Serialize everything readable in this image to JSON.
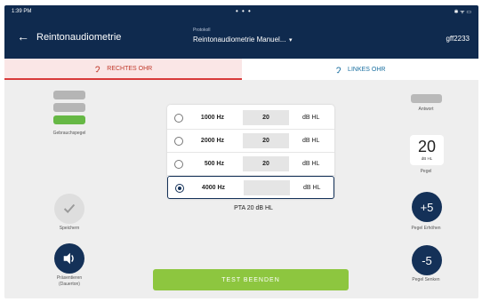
{
  "status_bar": {
    "time": "1:39 PM",
    "dots": "• • •",
    "icons": "✱ ᯤ ▭"
  },
  "app_bar": {
    "back_icon": "←",
    "title": "Reintonaudiometrie",
    "protocol_label": "Protokoll",
    "protocol_value": "Reintonaudiometrie Manuel...",
    "dropdown_icon": "▾",
    "user": "gff2233"
  },
  "tabs": {
    "right": {
      "label": "RECHTES OHR",
      "color": "#c0392b"
    },
    "left": {
      "label": "LINKES OHR",
      "color": "#1a6fa0"
    }
  },
  "left_panel": {
    "comfort_level_label": "Gebrauchspegel",
    "level_bar_colors": [
      "#b5b5b5",
      "#b5b5b5",
      "#66b845"
    ],
    "save_label": "Speichern",
    "present_label_1": "Präsentieren",
    "present_label_2": "(Dauerton)"
  },
  "right_panel": {
    "answer_label": "Antwort",
    "level_value": "20",
    "level_unit": "dB HL",
    "level_label": "Pegel",
    "increase_symbol": "+5",
    "increase_label": "Pegel Erhöhen",
    "decrease_symbol": "-5",
    "decrease_label": "Pegel Senken"
  },
  "frequencies": [
    {
      "freq": "1000 Hz",
      "value": "20",
      "unit": "dB HL",
      "selected": false
    },
    {
      "freq": "2000 Hz",
      "value": "20",
      "unit": "dB HL",
      "selected": false
    },
    {
      "freq": "500 Hz",
      "value": "20",
      "unit": "dB HL",
      "selected": false
    },
    {
      "freq": "4000 Hz",
      "value": "",
      "unit": "dB HL",
      "selected": true
    }
  ],
  "pta": "PTA 20 dB HL",
  "test_end_label": "TEST BEENDEN",
  "colors": {
    "navy": "#0f2a4e",
    "accent_green": "#8dc63f"
  }
}
